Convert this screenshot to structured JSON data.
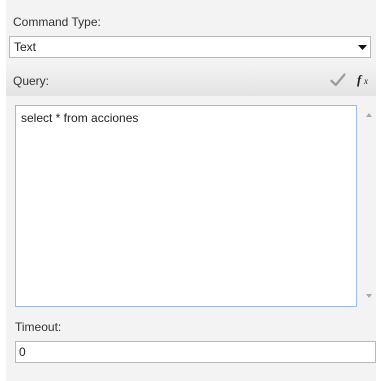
{
  "command_type": {
    "label": "Command Type:",
    "selected_value": "Text",
    "dropdown_icon": "chevron-down-icon"
  },
  "query": {
    "label": "Query:",
    "validate_icon": "checkmark-icon",
    "function_icon": "fx-icon",
    "value": "select * from acciones"
  },
  "timeout": {
    "label": "Timeout:",
    "value": "0"
  }
}
